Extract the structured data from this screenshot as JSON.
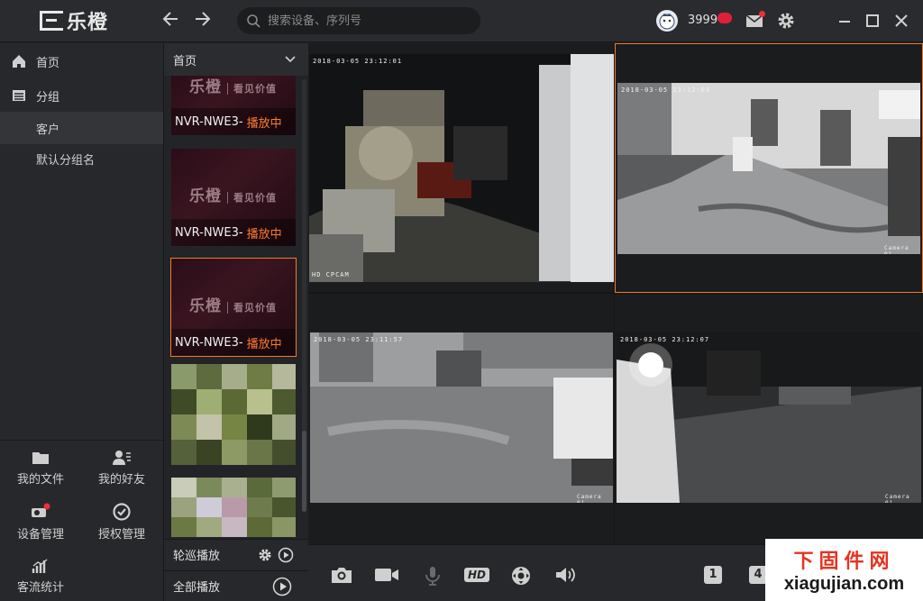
{
  "app": {
    "brand": "乐橙",
    "search_placeholder": "搜索设备、序列号",
    "username": "3999"
  },
  "sidebar": {
    "items": [
      {
        "label": "首页",
        "icon": "home-icon"
      },
      {
        "label": "分组",
        "icon": "list-icon"
      },
      {
        "label": "客户"
      },
      {
        "label": "默认分组名"
      }
    ],
    "tools": [
      {
        "label": "我的文件",
        "icon": "folder-icon"
      },
      {
        "label": "我的好友",
        "icon": "friends-icon"
      },
      {
        "label": "设备管理",
        "icon": "device-manage-icon"
      },
      {
        "label": "授权管理",
        "icon": "auth-manage-icon"
      },
      {
        "label": "客流统计",
        "icon": "stats-icon"
      }
    ]
  },
  "device_list": {
    "header": "首页",
    "brand_text": "乐橙",
    "brand_tag": "看见价值",
    "items": [
      {
        "name": "NVR-NWE3-",
        "status": "播放中"
      },
      {
        "name": "NVR-NWE3-",
        "status": "播放中"
      },
      {
        "name": "NVR-NWE3-",
        "status": "播放中"
      }
    ],
    "patrol_label": "轮巡播放",
    "play_all_label": "全部播放"
  },
  "videos": [
    {
      "timestamp": "2018-03-05 23:12:01",
      "caption": "HD CPCAM"
    },
    {
      "timestamp": "2018-03-05 23:12:03",
      "caption": "Camera 01"
    },
    {
      "timestamp": "2018-03-05 23:11:57",
      "caption": "Camera 01"
    },
    {
      "timestamp": "2018-03-05 23:12:07",
      "caption": "Camera 01"
    }
  ],
  "toolbar": {
    "hd_label": "HD",
    "layout1_label": "1",
    "layout4_label": "4"
  },
  "watermark": {
    "line1": "下固件网",
    "line2": "xiagujian.com"
  },
  "colors": {
    "accent": "#f07b2a",
    "playing": "#ff7a2e",
    "badge": "#e0203a"
  }
}
